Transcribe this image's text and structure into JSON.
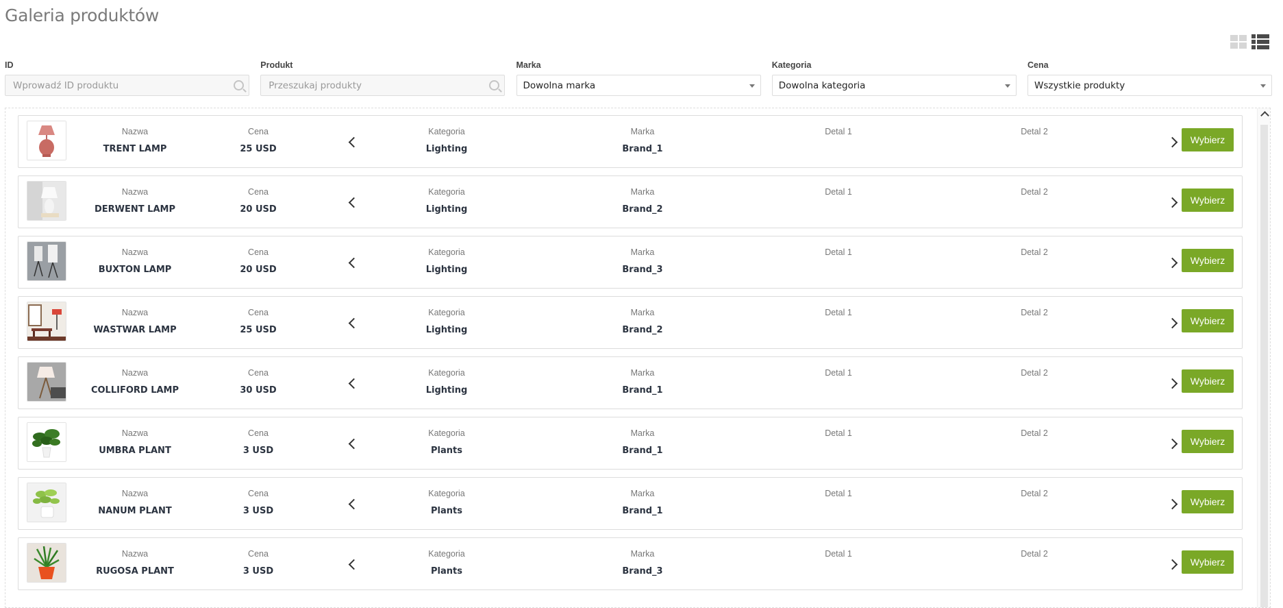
{
  "page": {
    "title": "Galeria produktów"
  },
  "view_toggle": {
    "grid_icon": "grid-view-icon",
    "list_icon": "list-view-icon",
    "active": "list"
  },
  "filters": {
    "id": {
      "label": "ID",
      "placeholder": "Wprowadź ID produktu",
      "value": ""
    },
    "product": {
      "label": "Produkt",
      "placeholder": "Przeszukaj produkty",
      "value": ""
    },
    "brand": {
      "label": "Marka",
      "selected": "Dowolna marka"
    },
    "category": {
      "label": "Kategoria",
      "selected": "Dowolna kategoria"
    },
    "price": {
      "label": "Cena",
      "selected": "Wszystkie produkty"
    }
  },
  "columns": {
    "name": "Nazwa",
    "price": "Cena",
    "category": "Kategoria",
    "brand": "Marka",
    "detail1": "Detal 1",
    "detail2": "Detal 2"
  },
  "select_label": "Wybierz",
  "products": [
    {
      "name": "TRENT LAMP",
      "price": "25 USD",
      "category": "Lighting",
      "brand": "Brand_1",
      "detail1": "",
      "detail2": ""
    },
    {
      "name": "DERWENT LAMP",
      "price": "20 USD",
      "category": "Lighting",
      "brand": "Brand_2",
      "detail1": "",
      "detail2": ""
    },
    {
      "name": "BUXTON LAMP",
      "price": "20 USD",
      "category": "Lighting",
      "brand": "Brand_3",
      "detail1": "",
      "detail2": ""
    },
    {
      "name": "WASTWAR LAMP",
      "price": "25 USD",
      "category": "Lighting",
      "brand": "Brand_2",
      "detail1": "",
      "detail2": ""
    },
    {
      "name": "COLLIFORD LAMP",
      "price": "30 USD",
      "category": "Lighting",
      "brand": "Brand_1",
      "detail1": "",
      "detail2": ""
    },
    {
      "name": "UMBRA PLANT",
      "price": "3 USD",
      "category": "Plants",
      "brand": "Brand_1",
      "detail1": "",
      "detail2": ""
    },
    {
      "name": "NANUM PLANT",
      "price": "3 USD",
      "category": "Plants",
      "brand": "Brand_1",
      "detail1": "",
      "detail2": ""
    },
    {
      "name": "RUGOSA PLANT",
      "price": "3 USD",
      "category": "Plants",
      "brand": "Brand_3",
      "detail1": "",
      "detail2": ""
    }
  ]
}
